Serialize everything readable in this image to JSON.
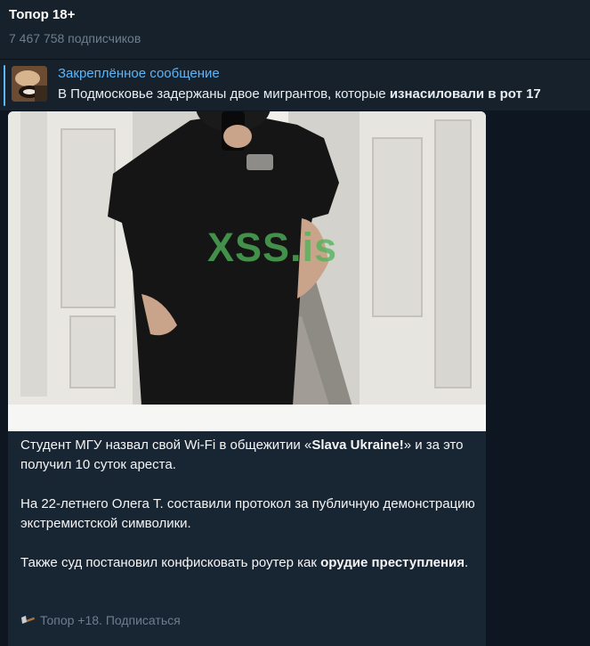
{
  "header": {
    "title": "Топор 18+",
    "subscribers": "7 467 758 подписчиков"
  },
  "pinned": {
    "label": "Закреплённое сообщение",
    "text_start": "В Подмосковье задержаны двое мигрантов, которые ",
    "text_bold": "изнасиловали в рот 17"
  },
  "post": {
    "watermark": "XSS.is",
    "p1_a": "Студент МГУ назвал свой Wi-Fi в общежитии «",
    "p1_bold": "Slava Ukraine!",
    "p1_b": "» и за это получил 10 суток ареста.",
    "p2": "На 22-летнего Олега Т. составили протокол за публичную демонстрацию экстремистской символики.",
    "p3_a": "Также суд постановил конфисковать роутер как ",
    "p3_bold": "орудие преступления",
    "p3_b": ".",
    "footer": "Топор +18. Подписаться"
  },
  "colors": {
    "background": "#0e1621",
    "panel": "#17212b",
    "bubble": "#182533",
    "accent": "#5eb5f7",
    "muted": "#6d7f8f"
  },
  "icons": [
    "pinned-thumbnail",
    "axe-emoji-icon"
  ]
}
